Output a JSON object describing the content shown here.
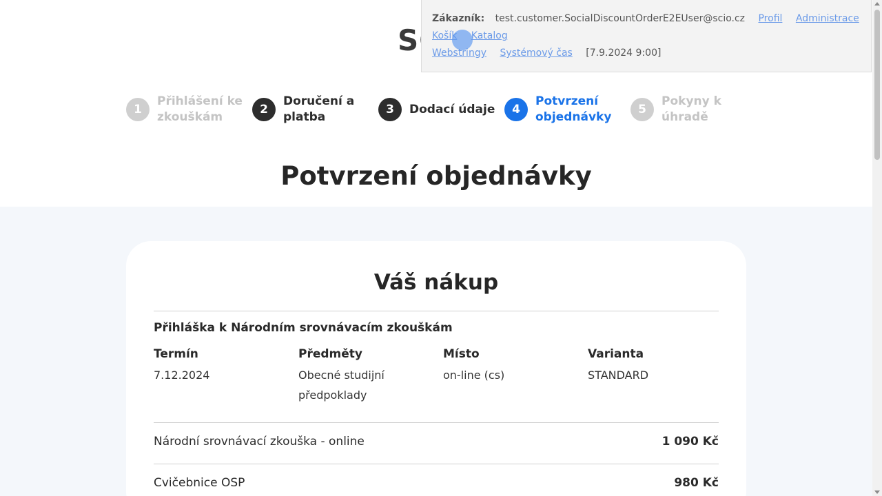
{
  "logo": "SCIO",
  "steps": [
    {
      "num": "1",
      "label": "Přihlášení ke zkouškám",
      "state": "future"
    },
    {
      "num": "2",
      "label": "Doručení a platba",
      "state": "done"
    },
    {
      "num": "3",
      "label": "Dodací údaje",
      "state": "done"
    },
    {
      "num": "4",
      "label": "Potvrzení objednávky",
      "state": "active"
    },
    {
      "num": "5",
      "label": "Pokyny k úhradě",
      "state": "future"
    }
  ],
  "page_title": "Potvrzení objednávky",
  "card": {
    "title": "Váš nákup",
    "section_title": "Přihláška k Národním srovnávacím zkouškám",
    "columns": [
      {
        "header": "Termín",
        "value": "7.12.2024"
      },
      {
        "header": "Předměty",
        "value": "Obecné studijní předpoklady"
      },
      {
        "header": "Místo",
        "value": "on-line (cs)"
      },
      {
        "header": "Varianta",
        "value": "STANDARD"
      }
    ],
    "items": [
      {
        "name": "Národní srovnávací zkouška - online",
        "price": "1 090 Kč"
      },
      {
        "name": "Cvičebnice OSP",
        "price": "980 Kč"
      }
    ]
  },
  "overlay": {
    "customer_label": "Zákazník:",
    "customer_email": "test.customer.SocialDiscountOrderE2EUser@scio.cz",
    "profil": "Profil",
    "administrace": "Administrace",
    "kosik": "Košík",
    "katalog": "Katalog",
    "webstringy": "Webstringy",
    "systemovy_cas": "Systémový čas",
    "time": "[7.9.2024 9:00]"
  },
  "colors": {
    "accent": "#1a73e8",
    "dark": "#2d2d2d",
    "muted": "#cfcfcf",
    "link": "#6a9ae8",
    "bg": "#f4f7fb"
  }
}
